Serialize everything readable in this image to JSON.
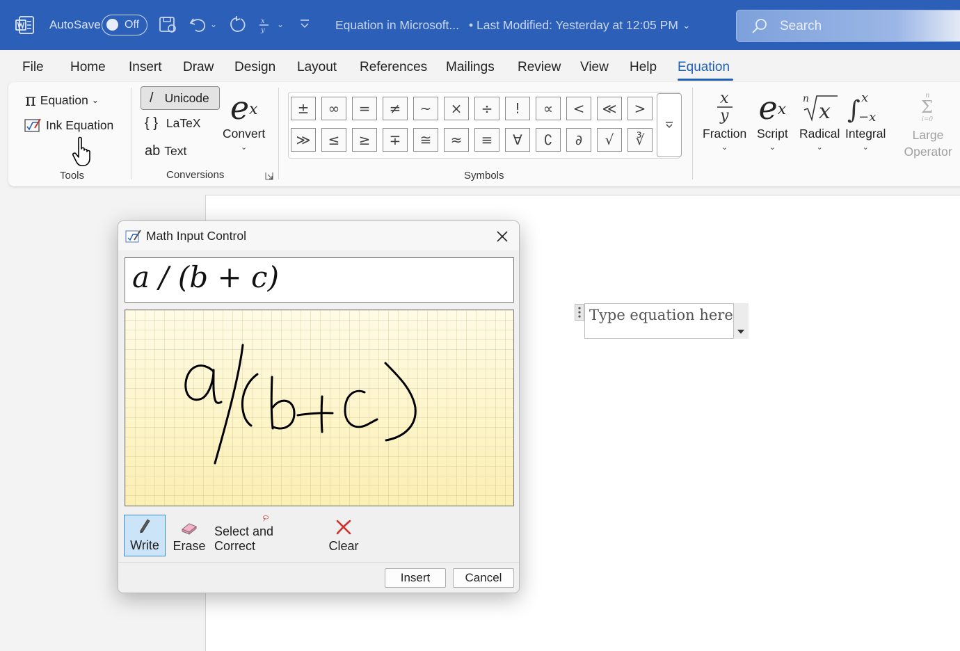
{
  "titlebar": {
    "autosave_label": "AutoSave",
    "autosave_state": "Off",
    "doc_title": "Equation in Microsoft...",
    "last_modified": "• Last Modified: Yesterday at 12:05 PM",
    "search_placeholder": "Search",
    "colors": {
      "background": "#2b5fb8"
    }
  },
  "menu": {
    "items": [
      "File",
      "Home",
      "Insert",
      "Draw",
      "Design",
      "Layout",
      "References",
      "Mailings",
      "Review",
      "View",
      "Help",
      "Equation"
    ],
    "active": "Equation"
  },
  "ribbon": {
    "tools": {
      "equation_label": "Equation",
      "ink_equation_label": "Ink Equation",
      "group_label": "Tools"
    },
    "conversions": {
      "unicode_label": "Unicode",
      "latex_label": "LaTeX",
      "text_label": "Text",
      "convert_label": "Convert",
      "group_label": "Conversions"
    },
    "symbols": {
      "row1": [
        "±",
        "∞",
        "=",
        "≠",
        "~",
        "×",
        "÷",
        "!",
        "∝",
        "<",
        "≪",
        ">"
      ],
      "row2": [
        "≫",
        "≤",
        "≥",
        "∓",
        "≅",
        "≈",
        "≡",
        "∀",
        "∁",
        "∂",
        "√",
        "∛"
      ],
      "group_label": "Symbols"
    },
    "structures": {
      "fraction_label": "Fraction",
      "script_label": "Script",
      "radical_label": "Radical",
      "integral_label": "Integral",
      "large_operator_label": "Large Operator"
    }
  },
  "document": {
    "equation_placeholder": "Type equation here."
  },
  "dialog": {
    "title": "Math Input Control",
    "preview": "a / (b + c)",
    "tools": {
      "write": "Write",
      "erase": "Erase",
      "select_correct": "Select and Correct",
      "clear": "Clear",
      "active": "Write"
    },
    "insert_label": "Insert",
    "cancel_label": "Cancel"
  }
}
